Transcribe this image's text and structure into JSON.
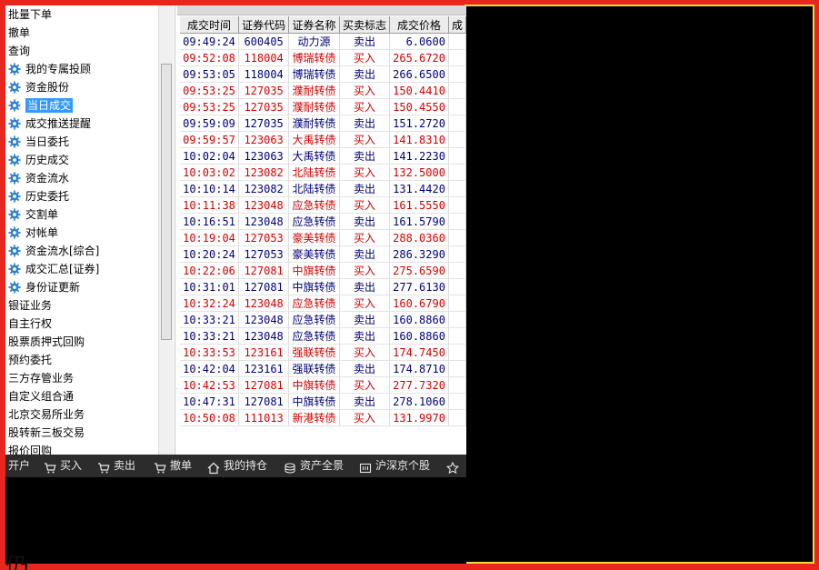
{
  "sidebar": {
    "items": [
      {
        "label": "批量下单",
        "level": 0
      },
      {
        "label": "撤单",
        "level": 0
      },
      {
        "label": "查询",
        "level": 0
      },
      {
        "label": "我的专属投顾",
        "level": 1
      },
      {
        "label": "资金股份",
        "level": 1
      },
      {
        "label": "当日成交",
        "level": 1,
        "selected": true
      },
      {
        "label": "成交推送提醒",
        "level": 1
      },
      {
        "label": "当日委托",
        "level": 1
      },
      {
        "label": "历史成交",
        "level": 1
      },
      {
        "label": "资金流水",
        "level": 1
      },
      {
        "label": "历史委托",
        "level": 1
      },
      {
        "label": "交割单",
        "level": 1
      },
      {
        "label": "对帐单",
        "level": 1
      },
      {
        "label": "资金流水[综合]",
        "level": 1
      },
      {
        "label": "成交汇总[证券]",
        "level": 1
      },
      {
        "label": "身份证更新",
        "level": 1
      },
      {
        "label": "银证业务",
        "level": 0
      },
      {
        "label": "自主行权",
        "level": 0
      },
      {
        "label": "股票质押式回购",
        "level": 0
      },
      {
        "label": "预约委托",
        "level": 0
      },
      {
        "label": "三方存管业务",
        "level": 0
      },
      {
        "label": "自定义组合通",
        "level": 0
      },
      {
        "label": "北京交易所业务",
        "level": 0
      },
      {
        "label": "股转新三板交易",
        "level": 0
      },
      {
        "label": "报价回购",
        "level": 0
      }
    ]
  },
  "table": {
    "columns": [
      "成交时间",
      "证券代码",
      "证券名称",
      "买卖标志",
      "成交价格",
      "成"
    ],
    "rows": [
      {
        "time": "09:49:24",
        "code": "600405",
        "name": "动力源",
        "side": "卖出",
        "price": "6.0600"
      },
      {
        "time": "09:52:08",
        "code": "118004",
        "name": "博瑞转债",
        "side": "买入",
        "price": "265.6720"
      },
      {
        "time": "09:53:05",
        "code": "118004",
        "name": "博瑞转债",
        "side": "卖出",
        "price": "266.6500"
      },
      {
        "time": "09:53:25",
        "code": "127035",
        "name": "濮耐转债",
        "side": "买入",
        "price": "150.4410"
      },
      {
        "time": "09:53:25",
        "code": "127035",
        "name": "濮耐转债",
        "side": "买入",
        "price": "150.4550"
      },
      {
        "time": "09:59:09",
        "code": "127035",
        "name": "濮耐转债",
        "side": "卖出",
        "price": "151.2720"
      },
      {
        "time": "09:59:57",
        "code": "123063",
        "name": "大禹转债",
        "side": "买入",
        "price": "141.8310"
      },
      {
        "time": "10:02:04",
        "code": "123063",
        "name": "大禹转债",
        "side": "卖出",
        "price": "141.2230"
      },
      {
        "time": "10:03:02",
        "code": "123082",
        "name": "北陆转债",
        "side": "买入",
        "price": "132.5000"
      },
      {
        "time": "10:10:14",
        "code": "123082",
        "name": "北陆转债",
        "side": "卖出",
        "price": "131.4420"
      },
      {
        "time": "10:11:38",
        "code": "123048",
        "name": "应急转债",
        "side": "买入",
        "price": "161.5550"
      },
      {
        "time": "10:16:51",
        "code": "123048",
        "name": "应急转债",
        "side": "卖出",
        "price": "161.5790"
      },
      {
        "time": "10:19:04",
        "code": "127053",
        "name": "豪美转债",
        "side": "买入",
        "price": "288.0360"
      },
      {
        "time": "10:20:24",
        "code": "127053",
        "name": "豪美转债",
        "side": "卖出",
        "price": "286.3290"
      },
      {
        "time": "10:22:06",
        "code": "127081",
        "name": "中旗转债",
        "side": "买入",
        "price": "275.6590"
      },
      {
        "time": "10:31:01",
        "code": "127081",
        "name": "中旗转债",
        "side": "卖出",
        "price": "277.6130"
      },
      {
        "time": "10:32:24",
        "code": "123048",
        "name": "应急转债",
        "side": "买入",
        "price": "160.6790"
      },
      {
        "time": "10:33:21",
        "code": "123048",
        "name": "应急转债",
        "side": "卖出",
        "price": "160.8860"
      },
      {
        "time": "10:33:21",
        "code": "123048",
        "name": "应急转债",
        "side": "卖出",
        "price": "160.8860"
      },
      {
        "time": "10:33:53",
        "code": "123161",
        "name": "强联转债",
        "side": "买入",
        "price": "174.7450"
      },
      {
        "time": "10:42:04",
        "code": "123161",
        "name": "强联转债",
        "side": "卖出",
        "price": "174.8710"
      },
      {
        "time": "10:42:53",
        "code": "127081",
        "name": "中旗转债",
        "side": "买入",
        "price": "277.7320"
      },
      {
        "time": "10:47:31",
        "code": "127081",
        "name": "中旗转债",
        "side": "卖出",
        "price": "278.1060"
      },
      {
        "time": "10:50:08",
        "code": "111013",
        "name": "新港转债",
        "side": "买入",
        "price": "131.9970"
      }
    ]
  },
  "toolbar": {
    "items": [
      {
        "label": "开户",
        "icon": "none"
      },
      {
        "label": "买入",
        "icon": "cart-icon"
      },
      {
        "label": "卖出",
        "icon": "cart-icon"
      },
      {
        "label": "撤单",
        "icon": "cart-icon"
      },
      {
        "label": "我的持仓",
        "icon": "home-icon"
      },
      {
        "label": "资产全景",
        "icon": "coins-icon"
      },
      {
        "label": "沪深京个股",
        "icon": "quote-icon"
      },
      {
        "label": "",
        "icon": "star-icon"
      }
    ]
  },
  "caption": "仍..."
}
